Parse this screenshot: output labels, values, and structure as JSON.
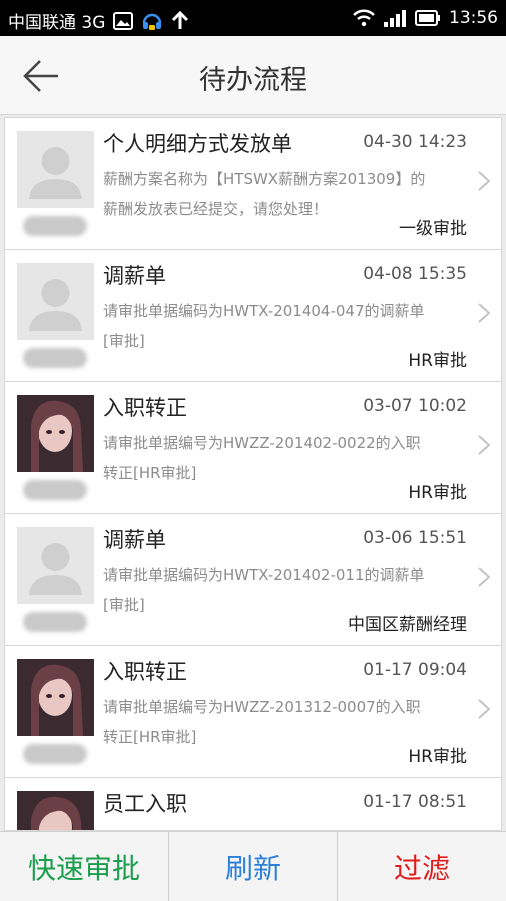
{
  "status_bar": {
    "carrier": "中国联通 3G",
    "time": "13:56"
  },
  "header": {
    "title": "待办流程"
  },
  "items": [
    {
      "title": "个人明细方式发放单",
      "time": "04-30 14:23",
      "desc": "薪酬方案名称为【HTSWX薪酬方案201309】的薪酬发放表已经提交，请您处理！",
      "stage": "一级审批",
      "avatar": "default-avatar"
    },
    {
      "title": "调薪单",
      "time": "04-08 15:35",
      "desc": "请审批单据编码为HWTX-201404-047的调薪单[审批]",
      "stage": "HR审批",
      "avatar": "default-avatar"
    },
    {
      "title": "入职转正",
      "time": "03-07 10:02",
      "desc": "请审批单据编号为HWZZ-201402-0022的入职转正[HR审批]",
      "stage": "HR审批",
      "avatar": "photo-avatar"
    },
    {
      "title": "调薪单",
      "time": "03-06 15:51",
      "desc": "请审批单据编码为HWTX-201402-011的调薪单[审批]",
      "stage": "中国区薪酬经理",
      "avatar": "default-avatar"
    },
    {
      "title": "入职转正",
      "time": "01-17 09:04",
      "desc": "请审批单据编号为HWZZ-201312-0007的入职转正[HR审批]",
      "stage": "HR审批",
      "avatar": "photo-avatar"
    },
    {
      "title": "员工入职",
      "time": "01-17 08:51",
      "desc": "",
      "stage": "",
      "avatar": "photo-avatar"
    }
  ],
  "bottom_bar": {
    "quick_approve": "快速审批",
    "refresh": "刷新",
    "filter": "过滤"
  },
  "colors": {
    "quick_approve": "#1a9e4e",
    "refresh": "#2b7fd9",
    "filter": "#e01b1b"
  }
}
